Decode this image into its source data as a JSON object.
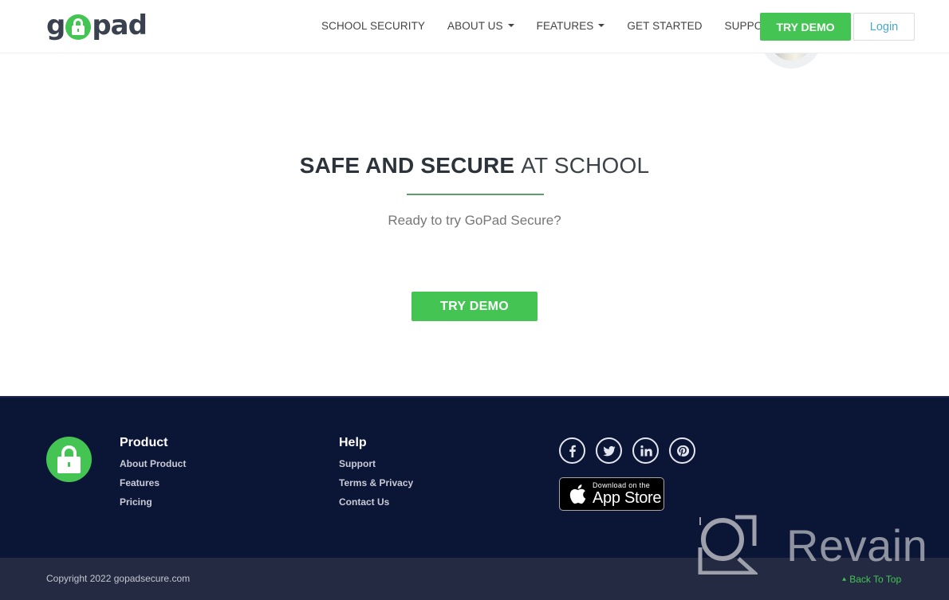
{
  "header": {
    "logo_text_left": "g",
    "logo_text_right": "pad",
    "nav": [
      {
        "label": "SCHOOL SECURITY",
        "dropdown": false
      },
      {
        "label": "ABOUT US",
        "dropdown": true
      },
      {
        "label": "FEATURES",
        "dropdown": true
      },
      {
        "label": "GET STARTED",
        "dropdown": false
      },
      {
        "label": "SUPPORT",
        "dropdown": false
      }
    ],
    "try_demo_label": "TRY DEMO",
    "login_label": "Login"
  },
  "hero": {
    "title_bold": "SAFE AND SECURE",
    "title_light": "AT SCHOOL",
    "subtitle": "Ready to try GoPad Secure?",
    "cta_label": "TRY DEMO"
  },
  "footer": {
    "product": {
      "heading": "Product",
      "links": [
        "About Product",
        "Features",
        "Pricing"
      ]
    },
    "help": {
      "heading": "Help",
      "links": [
        "Support",
        "Terms & Privacy",
        "Contact Us"
      ]
    },
    "socials": [
      {
        "name": "facebook",
        "glyph": "f"
      },
      {
        "name": "twitter",
        "glyph": "t"
      },
      {
        "name": "linkedin",
        "glyph": "in"
      },
      {
        "name": "pinterest",
        "glyph": "p"
      }
    ],
    "appstore": {
      "small": "Download on the",
      "big": "App Store"
    },
    "copyright": "Copyright 2022 gopadsecure.com",
    "back_to_top": "Back To Top"
  },
  "watermark": {
    "text": "Revain"
  },
  "colors": {
    "brand_green": "#44c553",
    "footer_bg": "#0b1535",
    "bottom_bar_bg": "#232a41",
    "login_text": "#4aa8c8"
  }
}
